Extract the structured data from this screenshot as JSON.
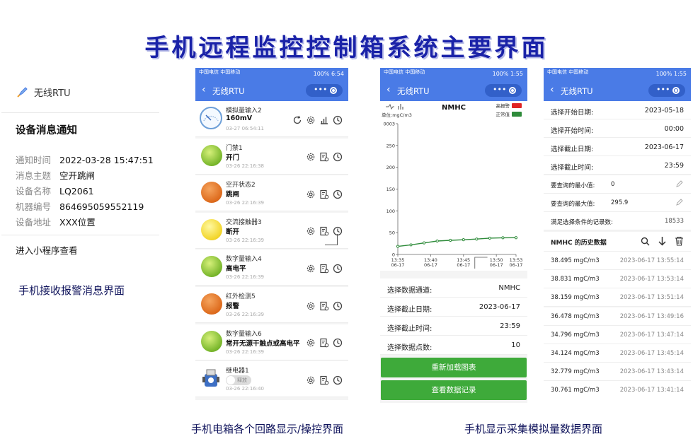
{
  "main_title": "手机远程监控控制箱系统主要界面",
  "captions": {
    "p1": "手机接收报警消息界面",
    "p2": "手机电箱各个回路显示/操控界面",
    "p3": "手机显示采集模拟量数据界面"
  },
  "notify": {
    "app_name": "无线RTU",
    "title": "设备消息通知",
    "fields": [
      {
        "k": "通知时间",
        "v": "2022-03-28 15:47:51"
      },
      {
        "k": "消息主题",
        "v": "空开跳闸"
      },
      {
        "k": "设备名称",
        "v": "LQ2061"
      },
      {
        "k": "机器编号",
        "v": "864695059552119"
      },
      {
        "k": "设备地址",
        "v": "XXX位置"
      }
    ],
    "link": "进入小程序查看"
  },
  "phone2": {
    "status_left": "中国电信 中国移动",
    "status_right": "100% 6:54",
    "title": "无线RTU",
    "items": [
      {
        "name": "模拟量输入2",
        "state": "160mV",
        "time": "03-27 06:54:11",
        "kind": "gauge"
      },
      {
        "name": "门禁1",
        "state": "开门",
        "time": "03-26 22:16:38",
        "kind": "green"
      },
      {
        "name": "空开状态2",
        "state": "跳闸",
        "time": "03-26 22:16:39",
        "kind": "orange"
      },
      {
        "name": "交流接触器3",
        "state": "断开",
        "time": "03-26 22:16:39",
        "kind": "yellow"
      },
      {
        "name": "数字量输入4",
        "state": "高电平",
        "time": "03-26 22:16:39",
        "kind": "green"
      },
      {
        "name": "红外检测5",
        "state": "报警",
        "time": "03-26 22:16:39",
        "kind": "orange"
      },
      {
        "name": "数字量输入6",
        "state": "常开无源干触点或高电平",
        "time": "03-26 22:16:39",
        "kind": "green"
      },
      {
        "name": "继电器1",
        "state": "",
        "time": "03-26 22:16:40",
        "kind": "relay"
      }
    ],
    "toggle_label": "释放"
  },
  "phone3": {
    "status_left": "中国电信 中国移动",
    "status_right": "100% 1:55",
    "title": "无线RTU",
    "legend_high": "高报警",
    "legend_normal": "正常值",
    "unit_label": "单位:mgC/m3",
    "form": [
      {
        "k": "选择数据通道:",
        "v": "NMHC"
      },
      {
        "k": "选择截止日期:",
        "v": "2023-06-17"
      },
      {
        "k": "选择截止时间:",
        "v": "23:59"
      },
      {
        "k": "选择数据点数:",
        "v": "10"
      }
    ],
    "btn_reload": "重新加载图表",
    "btn_records": "查看数据记录"
  },
  "chart_data": {
    "type": "line",
    "title": "NMHC",
    "xlabel": "",
    "ylabel": "单位:mgC/m3",
    "y_ticks": [
      "0",
      "50",
      "100",
      "150",
      "200",
      "250",
      "0003"
    ],
    "ylim": [
      0,
      300
    ],
    "x_ticks": [
      "13:35\n06-17",
      "13:40\n06-17",
      "13:45\n06-17",
      "13:50\n06-17",
      "13:53\n06-17"
    ],
    "x_tick_values": [
      0,
      5,
      10,
      15,
      18
    ],
    "x": [
      0,
      2,
      4,
      6,
      8,
      10,
      12,
      14,
      16,
      18
    ],
    "series": [
      {
        "name": "正常值",
        "values": [
          18.5,
          22.0,
          26.5,
          30.8,
          32.5,
          33.8,
          35.3,
          37.4,
          38.3,
          38.5
        ]
      }
    ],
    "grid": false,
    "legend": "top-right"
  },
  "phone4": {
    "status_left": "中国电信 中国移动",
    "status_right": "100% 1:55",
    "title": "无线RTU",
    "filters": [
      {
        "k": "选择开始日期:",
        "v": "2023-05-18"
      },
      {
        "k": "选择开始时间:",
        "v": "00:00"
      },
      {
        "k": "选择截止日期:",
        "v": "2023-06-17"
      },
      {
        "k": "选择截止时间:",
        "v": "23:59"
      }
    ],
    "min_label": "要查询的最小值:",
    "min_value": "0",
    "max_label": "要查询的最大值:",
    "max_value": "295.9",
    "count_label": "满足选择条件的记录数:",
    "count_value": "18533",
    "history_title": "NMHC 的历史数据",
    "records": [
      {
        "v": "38.495 mgC/m3",
        "t": "2023-06-17 13:55:14"
      },
      {
        "v": "38.831 mgC/m3",
        "t": "2023-06-17 13:53:14"
      },
      {
        "v": "38.159 mgC/m3",
        "t": "2023-06-17 13:51:14"
      },
      {
        "v": "36.478 mgC/m3",
        "t": "2023-06-17 13:49:16"
      },
      {
        "v": "34.796 mgC/m3",
        "t": "2023-06-17 13:47:14"
      },
      {
        "v": "34.124 mgC/m3",
        "t": "2023-06-17 13:45:14"
      },
      {
        "v": "32.779 mgC/m3",
        "t": "2023-06-17 13:43:14"
      },
      {
        "v": "30.761 mgC/m3",
        "t": "2023-06-17 13:41:14"
      }
    ]
  },
  "colors": {
    "accent": "#4a7be6",
    "button": "#3eaa3a",
    "title": "#1a22a8",
    "line": "#2e8b3a",
    "alarm": "#e02424"
  }
}
